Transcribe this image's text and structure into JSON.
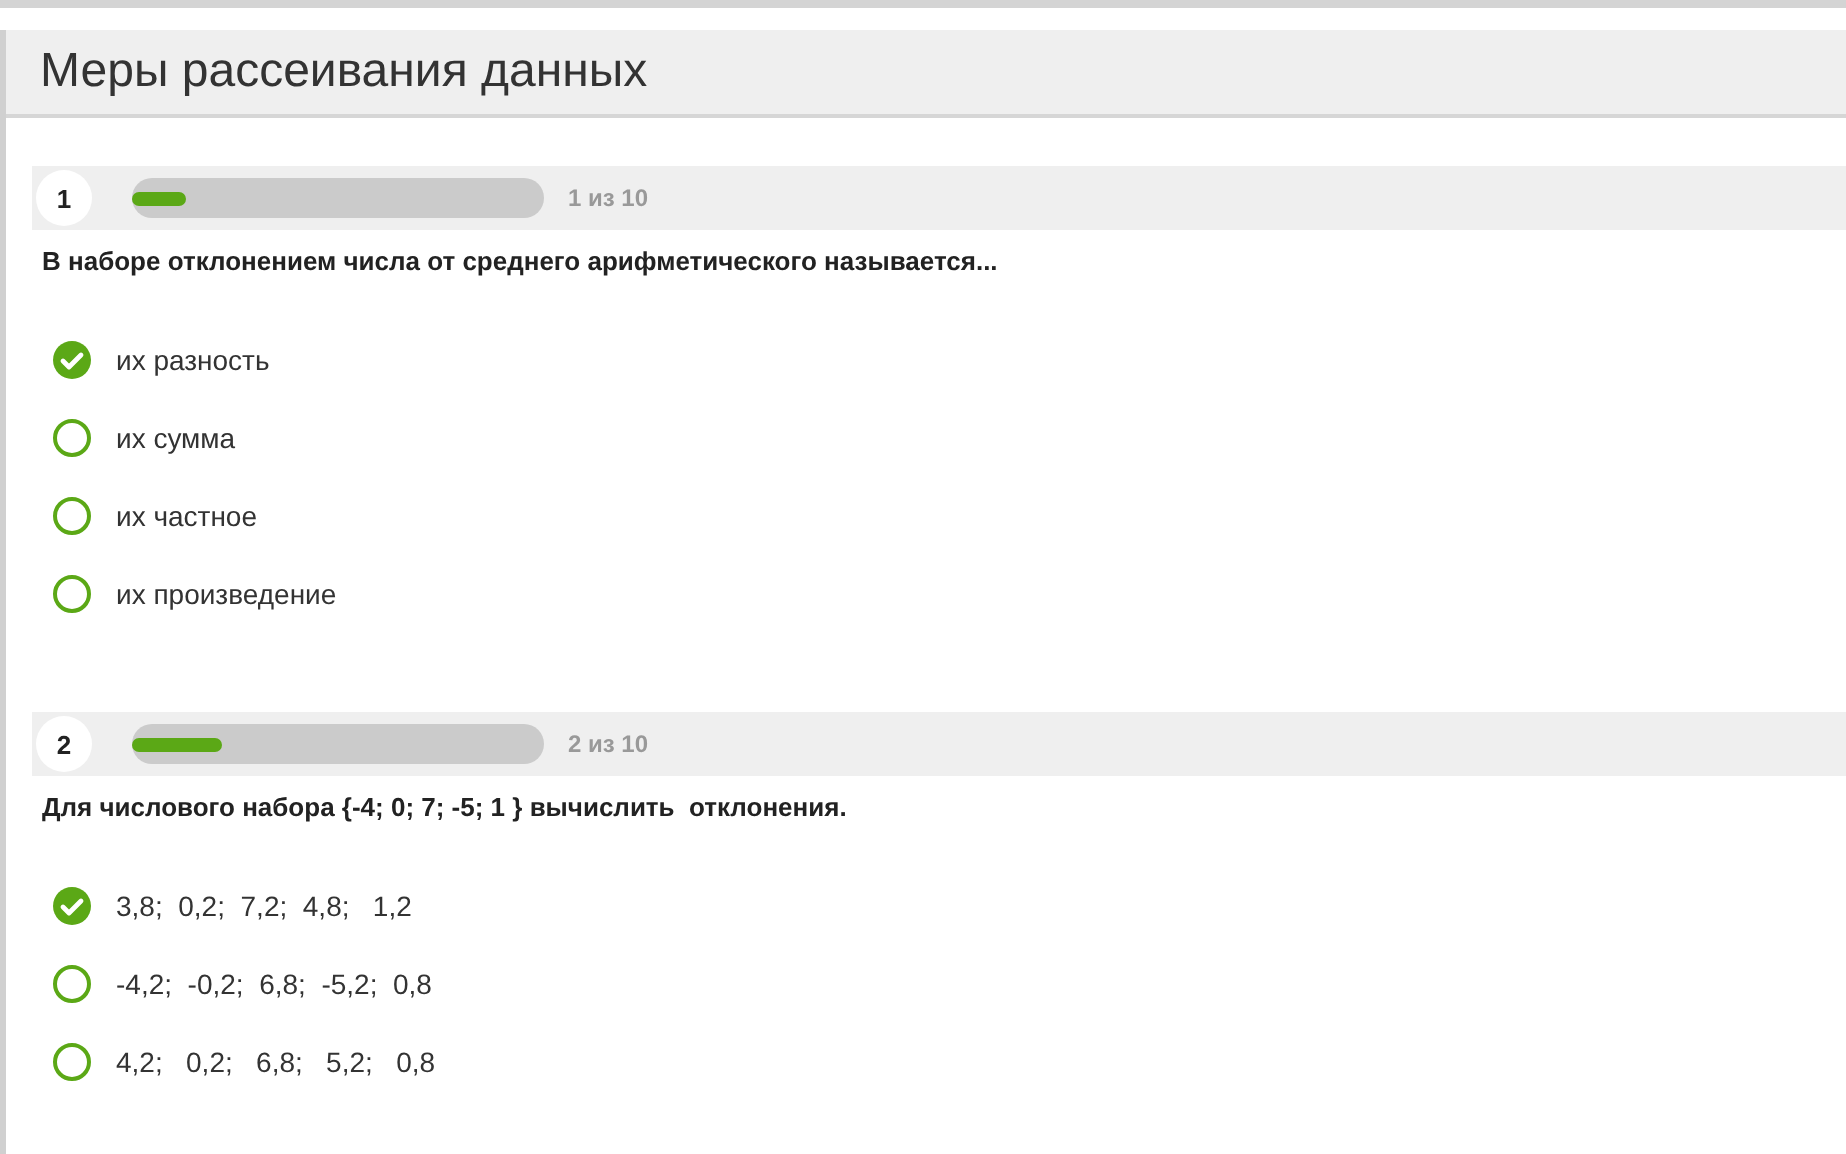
{
  "page": {
    "title": "Меры рассеивания данных"
  },
  "questions": [
    {
      "number": "1",
      "level": 0.13,
      "progress": "1 из 10",
      "text": "В наборе отклонением числа от среднего арифметического называется...",
      "options": [
        {
          "label": "их разность",
          "selected": true
        },
        {
          "label": "их сумма",
          "selected": false
        },
        {
          "label": "их частное",
          "selected": false
        },
        {
          "label": "их произведение",
          "selected": false
        }
      ]
    },
    {
      "number": "2",
      "level": 0.22,
      "progress": "2 из 10",
      "text": "Для числового набора {-4; 0; 7; -5; 1 } вычислить  отклонения.",
      "options": [
        {
          "label": "3,8;  0,2;  7,2;  4,8;   1,2",
          "selected": true
        },
        {
          "label": "-4,2;  -0,2;  6,8;  -5,2;  0,8",
          "selected": false
        },
        {
          "label": "4,2;   0,2;   6,8;   5,2;   0,8",
          "selected": false
        }
      ]
    }
  ]
}
